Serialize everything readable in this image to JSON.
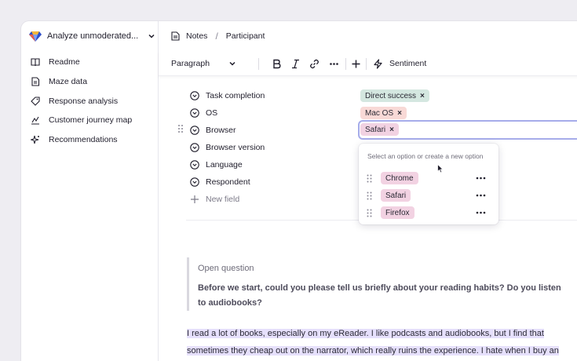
{
  "colors": {
    "accent": "#a6acea",
    "highlight": "#e6e0fc",
    "tag_green": "#d4e7e0",
    "tag_red": "#f8d9d6",
    "tag_pink": "#f2d2e2"
  },
  "sidebar": {
    "workspace_title": "Analyze unmoderated...",
    "items": [
      {
        "label": "Readme",
        "icon": "book-icon"
      },
      {
        "label": "Maze data",
        "icon": "document-icon"
      },
      {
        "label": "Response analysis",
        "icon": "tag-icon"
      },
      {
        "label": "Customer journey map",
        "icon": "journey-icon"
      },
      {
        "label": "Recommendations",
        "icon": "sparkle-icon"
      }
    ]
  },
  "breadcrumb": {
    "root": "Notes",
    "separator": "/",
    "current": "Participant"
  },
  "toolbar": {
    "paragraph": "Paragraph",
    "sentiment": "Sentiment"
  },
  "fields": [
    {
      "label": "Task completion",
      "value": "Direct success"
    },
    {
      "label": "OS",
      "value": "Mac OS"
    },
    {
      "label": "Browser",
      "value": "Safari"
    },
    {
      "label": "Browser version"
    },
    {
      "label": "Language"
    },
    {
      "label": "Respondent"
    }
  ],
  "new_field": "New field",
  "dropdown": {
    "hint": "Select an option or create a new option",
    "options": [
      "Chrome",
      "Safari",
      "Firefox"
    ]
  },
  "question": {
    "label": "Open question",
    "text": "Before we start, could you please tell us briefly about your reading habits? Do you listen to audiobooks?"
  },
  "answer": {
    "line1": "I read a lot of books, especially on my eReader. I like podcasts and audiobooks, but I find that",
    "line2": "sometimes they cheap out on the narrator, which really ruins the experience. I hate when I buy an"
  }
}
